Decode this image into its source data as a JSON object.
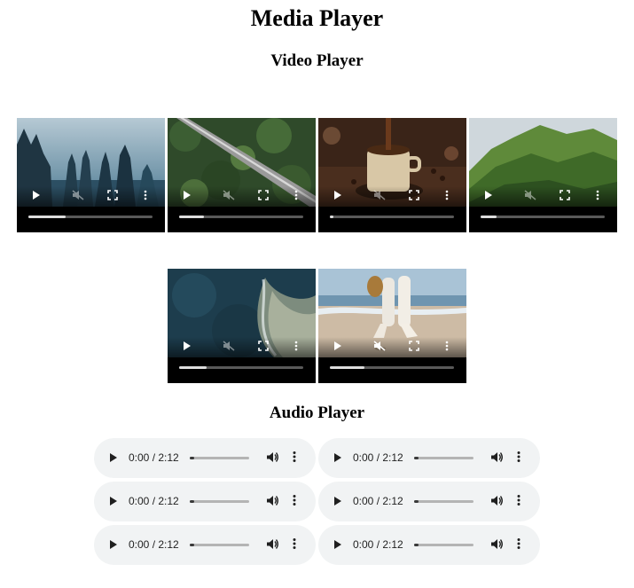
{
  "page": {
    "title": "Media Player",
    "video_section_title": "Video Player",
    "audio_section_title": "Audio Player"
  },
  "videos": [
    {
      "scene": "misty-forest",
      "progress": 0.3,
      "muted": false
    },
    {
      "scene": "aerial-road",
      "progress": 0.2,
      "muted": false
    },
    {
      "scene": "coffee-cup",
      "progress": 0.03,
      "muted": false
    },
    {
      "scene": "green-mountains",
      "progress": 0.13,
      "muted": false
    },
    {
      "scene": "aerial-coast",
      "progress": 0.22,
      "muted": false
    },
    {
      "scene": "beach-walk",
      "progress": 0.28,
      "muted": true
    }
  ],
  "audios": [
    {
      "time": "0:00 / 2:12"
    },
    {
      "time": "0:00 / 2:12"
    },
    {
      "time": "0:00 / 2:12"
    },
    {
      "time": "0:00 / 2:12"
    },
    {
      "time": "0:00 / 2:12"
    },
    {
      "time": "0:00 / 2:12"
    }
  ],
  "icons": {
    "play": "play-icon",
    "mute": "mute-icon",
    "volume": "volume-icon",
    "fullscreen": "fullscreen-icon",
    "menu": "more-vertical-icon"
  },
  "colors": {
    "audio_bg": "#f1f3f4",
    "video_controls": "#ffffff"
  }
}
